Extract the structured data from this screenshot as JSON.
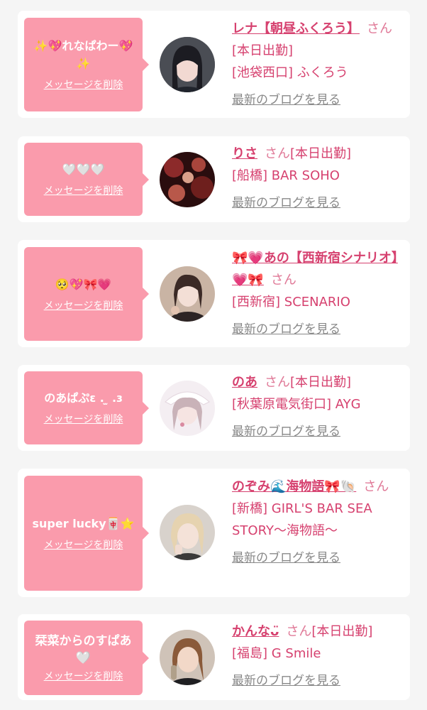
{
  "cards": [
    {
      "message": "✨💖れなぱわー💖✨",
      "delete_label": "メッセージを削除",
      "name": "レナ【朝昼ふくろう】",
      "honorific": "さん",
      "status": "[本日出勤]",
      "shop": "[池袋西口] ふくろう",
      "blog_label": "最新のブログを見る"
    },
    {
      "message": "🤍🤍🤍",
      "delete_label": "メッセージを削除",
      "name": "りさ",
      "honorific": "さん",
      "status": "[本日出勤]",
      "shop": "[船橋] BAR SOHO",
      "blog_label": "最新のブログを見る"
    },
    {
      "message": "🥺💖🎀💗",
      "delete_label": "メッセージを削除",
      "name": "🎀💗あの【西新宿シナリオ】💗🎀",
      "honorific": "さん",
      "status": "",
      "shop": "[西新宿] SCENARIO",
      "blog_label": "最新のブログを見る"
    },
    {
      "message": "のあぱぷɛ . ̫ .ɜ",
      "delete_label": "メッセージを削除",
      "name": "のあ",
      "honorific": "さん",
      "status": "[本日出勤]",
      "shop": "[秋葉原電気街口] AYG",
      "blog_label": "最新のブログを見る"
    },
    {
      "message": "super lucky🀄⭐",
      "delete_label": "メッセージを削除",
      "name": "のぞみ🌊海物語🎀🐚",
      "honorific": "さん",
      "status": "",
      "shop": "[新橋] GIRL'S BAR SEA STORY〜海物語〜",
      "blog_label": "最新のブログを見る"
    },
    {
      "message": "栞菜からのすぱあ🤍",
      "delete_label": "メッセージを削除",
      "name": "かんなᴗ̈",
      "honorific": "さん",
      "status": "[本日出勤]",
      "shop": "[福島] G Smile",
      "blog_label": "最新のブログを見る"
    }
  ]
}
